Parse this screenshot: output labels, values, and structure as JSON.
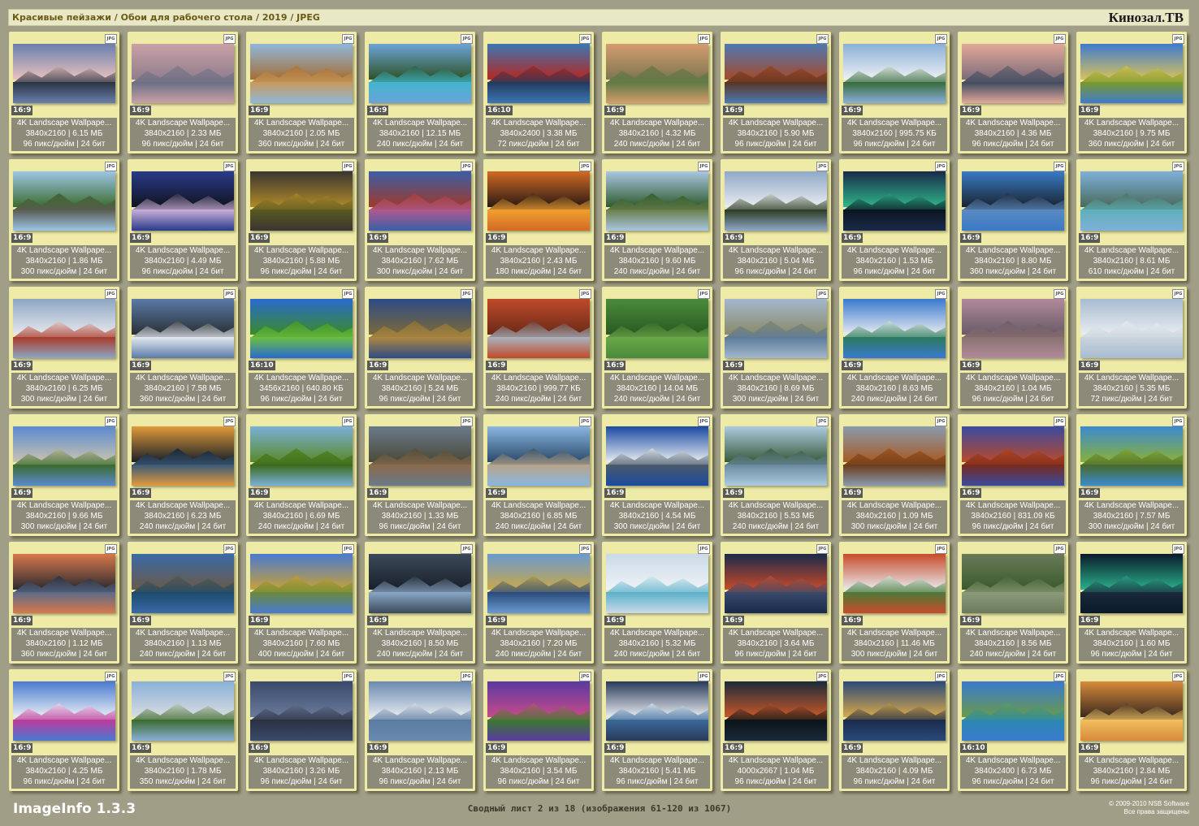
{
  "header": {
    "path": "Красивые пейзажи / Обои для рабочего стола / 2019 / JPEG",
    "brand": "Кинозал.ТВ"
  },
  "file_type_badge": "JPG",
  "item_title": "4K Landscape Wallpape...",
  "thumbnails": [
    {
      "ratio": "16:9",
      "size": "3840x2160 | 6.15 МБ",
      "dpi": "96 пикс/дюйм | 24 бит",
      "palette": [
        "#6a7fae",
        "#e9c2bf",
        "#2a3340"
      ]
    },
    {
      "ratio": "16:9",
      "size": "3840x2160 | 2.33 МБ",
      "dpi": "96 пикс/дюйм | 24 бит",
      "palette": [
        "#c9a1a6",
        "#8f7e8c",
        "#6a6e85"
      ]
    },
    {
      "ratio": "16:9",
      "size": "3840x2160 | 2.05 МБ",
      "dpi": "360 пикс/дюйм | 24 бит",
      "palette": [
        "#8fb7da",
        "#a56e35",
        "#c9995b"
      ]
    },
    {
      "ratio": "16:9",
      "size": "3840x2160 | 12.15 МБ",
      "dpi": "240 пикс/дюйм | 24 бит",
      "palette": [
        "#6ba3d6",
        "#2e5226",
        "#41b6cf"
      ]
    },
    {
      "ratio": "16:10",
      "size": "3840x2400 | 3.38 МБ",
      "dpi": "72 пикс/дюйм | 24 бит",
      "palette": [
        "#3b77b3",
        "#b8261e",
        "#22395c"
      ]
    },
    {
      "ratio": "16:9",
      "size": "3840x2160 | 4.32 МБ",
      "dpi": "240 пикс/дюйм | 24 бит",
      "palette": [
        "#d69c6e",
        "#7c7650",
        "#5c7a44"
      ]
    },
    {
      "ratio": "16:9",
      "size": "3840x2160 | 5.90 МБ",
      "dpi": "96 пикс/дюйм | 24 бит",
      "palette": [
        "#4e79b2",
        "#a54a2a",
        "#5a3422"
      ]
    },
    {
      "ratio": "16:9",
      "size": "3840x2160 | 995.75 КБ",
      "dpi": "96 пикс/дюйм | 24 бит",
      "palette": [
        "#8ab0d8",
        "#eef0f4",
        "#356a3a"
      ]
    },
    {
      "ratio": "16:9",
      "size": "3840x2160 | 4.36 МБ",
      "dpi": "96 пикс/дюйм | 24 бит",
      "palette": [
        "#e2a89a",
        "#7c6c78",
        "#3e4a5e"
      ]
    },
    {
      "ratio": "16:9",
      "size": "3840x2160 | 9.75 МБ",
      "dpi": "360 пикс/дюйм | 24 бит",
      "palette": [
        "#3f7ad0",
        "#d8c25a",
        "#7b9a2a"
      ]
    },
    {
      "ratio": "16:9",
      "size": "3840x2160 | 1.86 МБ",
      "dpi": "300 пикс/дюйм | 24 бит",
      "palette": [
        "#9cc6e6",
        "#3b6b2e",
        "#5a5a50"
      ]
    },
    {
      "ratio": "16:9",
      "size": "3840x2160 | 4.49 МБ",
      "dpi": "96 пикс/дюйм | 24 бит",
      "palette": [
        "#2a3a8a",
        "#101420",
        "#c9b0d9"
      ]
    },
    {
      "ratio": "16:9",
      "size": "3840x2160 | 5.88 МБ",
      "dpi": "96 пикс/дюйм | 24 бит",
      "palette": [
        "#3a3530",
        "#b08a2a",
        "#5a5a20"
      ]
    },
    {
      "ratio": "16:9",
      "size": "3840x2160 | 7.62 МБ",
      "dpi": "300 пикс/дюйм | 24 бит",
      "palette": [
        "#3b5ea6",
        "#9e3a2a",
        "#b05a8e"
      ]
    },
    {
      "ratio": "16:9",
      "size": "3840x2160 | 2.43 МБ",
      "dpi": "180 пикс/дюйм | 24 бит",
      "palette": [
        "#d26a24",
        "#2a1a14",
        "#f0a030"
      ]
    },
    {
      "ratio": "16:9",
      "size": "3840x2160 | 9.60 МБ",
      "dpi": "240 пикс/дюйм | 24 бит",
      "palette": [
        "#a9c7e2",
        "#2d5a2c",
        "#6a7e4a"
      ]
    },
    {
      "ratio": "16:9",
      "size": "3840x2160 | 5.04 МБ",
      "dpi": "96 пикс/дюйм | 24 бит",
      "palette": [
        "#8fa8c8",
        "#e9ecef",
        "#2a3a20"
      ]
    },
    {
      "ratio": "16:9",
      "size": "3840x2160 | 1.53 МБ",
      "dpi": "96 пикс/дюйм | 24 бит",
      "palette": [
        "#1a2a4a",
        "#2fb58a",
        "#0a1420"
      ]
    },
    {
      "ratio": "16:9",
      "size": "3840x2160 | 8.80 МБ",
      "dpi": "360 пикс/дюйм | 24 бит",
      "palette": [
        "#3a7ac6",
        "#1a2430",
        "#5a8ac0"
      ]
    },
    {
      "ratio": "16:9",
      "size": "3840x2160 | 8.61 МБ",
      "dpi": "610 пикс/дюйм | 24 бит",
      "palette": [
        "#7eb0da",
        "#4a6a5a",
        "#5fb0b8"
      ]
    },
    {
      "ratio": "16:9",
      "size": "3840x2160 | 6.25 МБ",
      "dpi": "300 пикс/дюйм | 24 бит",
      "palette": [
        "#8ea6c4",
        "#e6e8ec",
        "#a83a2a"
      ]
    },
    {
      "ratio": "16:9",
      "size": "3840x2160 | 7.58 МБ",
      "dpi": "360 пикс/дюйм | 24 бит",
      "palette": [
        "#5a7aa6",
        "#2a3036",
        "#e4eaf0"
      ]
    },
    {
      "ratio": "16:10",
      "size": "3456x2160 | 640.80 КБ",
      "dpi": "96 пикс/дюйм | 24 бит",
      "palette": [
        "#2a6ad0",
        "#3a8a2a",
        "#6cc040"
      ]
    },
    {
      "ratio": "16:9",
      "size": "3840x2160 | 5.24 МБ",
      "dpi": "96 пикс/дюйм | 24 бит",
      "palette": [
        "#2e4a86",
        "#7a6a3a",
        "#b08840"
      ]
    },
    {
      "ratio": "16:9",
      "size": "3840x2160 | 999.77 КБ",
      "dpi": "240 пикс/дюйм | 24 бит",
      "palette": [
        "#c04a2a",
        "#6a2a18",
        "#a8b4c0"
      ]
    },
    {
      "ratio": "16:9",
      "size": "3840x2160 | 14.04 МБ",
      "dpi": "240 пикс/дюйм | 24 бит",
      "palette": [
        "#4a8a3a",
        "#2a5a22",
        "#6aa848"
      ]
    },
    {
      "ratio": "16:9",
      "size": "3840x2160 | 8.69 МБ",
      "dpi": "300 пикс/дюйм | 24 бит",
      "palette": [
        "#a4b8cc",
        "#8a8a6a",
        "#5a7a9a"
      ]
    },
    {
      "ratio": "16:9",
      "size": "3840x2160 | 8.63 МБ",
      "dpi": "240 пикс/дюйм | 24 бит",
      "palette": [
        "#3a7ad0",
        "#e8ecef",
        "#2a7a5a"
      ]
    },
    {
      "ratio": "16:9",
      "size": "3840x2160 | 1.04 МБ",
      "dpi": "96 пикс/дюйм | 24 бит",
      "palette": [
        "#b08a9a",
        "#6a5a68",
        "#8a7070"
      ]
    },
    {
      "ratio": "16:9",
      "size": "3840x2160 | 5.35 МБ",
      "dpi": "72 пикс/дюйм | 24 бит",
      "palette": [
        "#a8bcd0",
        "#e8ecf0",
        "#cad4dc"
      ]
    },
    {
      "ratio": "16:9",
      "size": "3840x2160 | 9.66 МБ",
      "dpi": "300 пикс/дюйм | 24 бит",
      "palette": [
        "#5a8ad0",
        "#c9c2b0",
        "#3a6a2a"
      ]
    },
    {
      "ratio": "16:9",
      "size": "3840x2160 | 6.23 МБ",
      "dpi": "240 пикс/дюйм | 24 бит",
      "palette": [
        "#e09a3a",
        "#1a2028",
        "#3a5a7a"
      ]
    },
    {
      "ratio": "16:9",
      "size": "3840x2160 | 6.69 МБ",
      "dpi": "240 пикс/дюйм | 24 бит",
      "palette": [
        "#7ab0d8",
        "#5a8a2a",
        "#3a6a1a"
      ]
    },
    {
      "ratio": "16:9",
      "size": "3840x2160 | 1.33 МБ",
      "dpi": "96 пикс/дюйм | 24 бит",
      "palette": [
        "#6a7a8a",
        "#4a4a3a",
        "#8a6a4a"
      ]
    },
    {
      "ratio": "16:9",
      "size": "3840x2160 | 6.85 МБ",
      "dpi": "240 пикс/дюйм | 24 бит",
      "palette": [
        "#8ab6e0",
        "#2a4a6a",
        "#b8a48a"
      ]
    },
    {
      "ratio": "16:9",
      "size": "3840x2160 | 4.54 МБ",
      "dpi": "300 пикс/дюйм | 24 бит",
      "palette": [
        "#1a4aa0",
        "#e8eef4",
        "#4a5a6a"
      ]
    },
    {
      "ratio": "16:9",
      "size": "3840x2160 | 5.53 МБ",
      "dpi": "240 пикс/дюйм | 24 бит",
      "palette": [
        "#aacbe0",
        "#3a5a3a",
        "#6a8aa0"
      ]
    },
    {
      "ratio": "16:9",
      "size": "3840x2160 | 1.09 МБ",
      "dpi": "300 пикс/дюйм | 24 бит",
      "palette": [
        "#8a9aae",
        "#a85a22",
        "#6a3a1a"
      ]
    },
    {
      "ratio": "16:9",
      "size": "3840x2160 | 831.09 КБ",
      "dpi": "96 пикс/дюйм | 24 бит",
      "palette": [
        "#3a4aa0",
        "#b84a2a",
        "#7a2a1a"
      ]
    },
    {
      "ratio": "16:9",
      "size": "3840x2160 | 7.57 МБ",
      "dpi": "300 пикс/дюйм | 24 бит",
      "palette": [
        "#3a8ad0",
        "#8ab03a",
        "#4a6a2a"
      ]
    },
    {
      "ratio": "16:9",
      "size": "3840x2160 | 1.12 МБ",
      "dpi": "360 пикс/дюйм | 24 бит",
      "palette": [
        "#d8784a",
        "#2a2a30",
        "#5a6a8a"
      ]
    },
    {
      "ratio": "16:9",
      "size": "3840x2160 | 1.13 МБ",
      "dpi": "240 пикс/дюйм | 24 бит",
      "palette": [
        "#3a6aa8",
        "#6a5a48",
        "#1a4a6a"
      ]
    },
    {
      "ratio": "16:9",
      "size": "3840x2160 | 7.60 МБ",
      "dpi": "400 пикс/дюйм | 24 бит",
      "palette": [
        "#4a7ad0",
        "#c8a03a",
        "#6a8a3a"
      ]
    },
    {
      "ratio": "16:9",
      "size": "3840x2160 | 8.50 МБ",
      "dpi": "240 пикс/дюйм | 24 бит",
      "palette": [
        "#3a4a5a",
        "#1a2028",
        "#8aa8c8"
      ]
    },
    {
      "ratio": "16:9",
      "size": "3840x2160 | 7.20 МБ",
      "dpi": "240 пикс/дюйм | 24 бит",
      "palette": [
        "#6a9ad0",
        "#c8a84a",
        "#2a4a7a"
      ]
    },
    {
      "ratio": "16:9",
      "size": "3840x2160 | 5.32 МБ",
      "dpi": "240 пикс/дюйм | 24 бит",
      "palette": [
        "#cadae8",
        "#eef2f6",
        "#5ab0c8"
      ]
    },
    {
      "ratio": "16:9",
      "size": "3840x2160 | 3.64 МБ",
      "dpi": "96 пикс/дюйм | 24 бит",
      "palette": [
        "#1a2a4a",
        "#c84a2a",
        "#3a4a6a"
      ]
    },
    {
      "ratio": "16:9",
      "size": "3840x2160 | 11.46 МБ",
      "dpi": "300 пикс/дюйм | 24 бит",
      "palette": [
        "#c84a2a",
        "#e8eaec",
        "#4a7a3a"
      ]
    },
    {
      "ratio": "16:9",
      "size": "3840x2160 | 8.56 МБ",
      "dpi": "240 пикс/дюйм | 24 бит",
      "palette": [
        "#6a7a5a",
        "#3a5a2a",
        "#8a9a7a"
      ]
    },
    {
      "ratio": "16:9",
      "size": "3840x2160 | 1.60 МБ",
      "dpi": "96 пикс/дюйм | 24 бит",
      "palette": [
        "#0a1a2a",
        "#2ab08a",
        "#1a2a3a"
      ]
    },
    {
      "ratio": "16:9",
      "size": "3840x2160 | 4.25 МБ",
      "dpi": "96 пикс/дюйм | 24 бит",
      "palette": [
        "#4a7ad0",
        "#e8eef4",
        "#c03a9a"
      ]
    },
    {
      "ratio": "16:9",
      "size": "3840x2160 | 1.78 МБ",
      "dpi": "350 пикс/дюйм | 24 бит",
      "palette": [
        "#8ab0d8",
        "#d8dce0",
        "#3a6a2a"
      ]
    },
    {
      "ratio": "16:9",
      "size": "3840x2160 | 3.26 МБ",
      "dpi": "96 пикс/дюйм | 24 бит",
      "palette": [
        "#3a4a6a",
        "#6a7a9a",
        "#2a3040"
      ]
    },
    {
      "ratio": "16:9",
      "size": "3840x2160 | 2.13 МБ",
      "dpi": "96 пикс/дюйм | 24 бит",
      "palette": [
        "#6a8ab0",
        "#e6eaee",
        "#5a7aa0"
      ]
    },
    {
      "ratio": "16:9",
      "size": "3840x2160 | 3.54 МБ",
      "dpi": "96 пикс/дюйм | 24 бит",
      "palette": [
        "#5a3aa0",
        "#c84a8a",
        "#3a7a2a"
      ]
    },
    {
      "ratio": "16:9",
      "size": "3840x2160 | 5.41 МБ",
      "dpi": "96 пикс/дюйм | 24 бит",
      "palette": [
        "#2a3a5a",
        "#e8ecf0",
        "#3a6a9a"
      ]
    },
    {
      "ratio": "16:9",
      "size": "4000x2667 | 1.04 МБ",
      "dpi": "96 пикс/дюйм | 24 бит",
      "palette": [
        "#1a2a3a",
        "#c8582a",
        "#0a1418"
      ]
    },
    {
      "ratio": "16:9",
      "size": "3840x2160 | 4.09 МБ",
      "dpi": "96 пикс/дюйм | 24 бит",
      "palette": [
        "#2a4a7a",
        "#d8a84a",
        "#1a2a4a"
      ]
    },
    {
      "ratio": "16:10",
      "size": "3840x2400 | 6.73 МБ",
      "dpi": "96 пикс/дюйм | 24 бит",
      "palette": [
        "#3a7ad0",
        "#6a9a4a",
        "#2a8ab0"
      ]
    },
    {
      "ratio": "16:9",
      "size": "3840x2160 | 2.84 МБ",
      "dpi": "96 пикс/дюйм | 24 бит",
      "palette": [
        "#d88a3a",
        "#3a2a20",
        "#f0c060"
      ]
    }
  ],
  "footer": {
    "app_name": "ImageInfo 1.3.3",
    "sheet_info": "Сводный лист 2 из 18 (изображения 61-120 из 1067)",
    "copyright": "© 2009-2010 NSB Software",
    "rights": "Все права защищены"
  }
}
